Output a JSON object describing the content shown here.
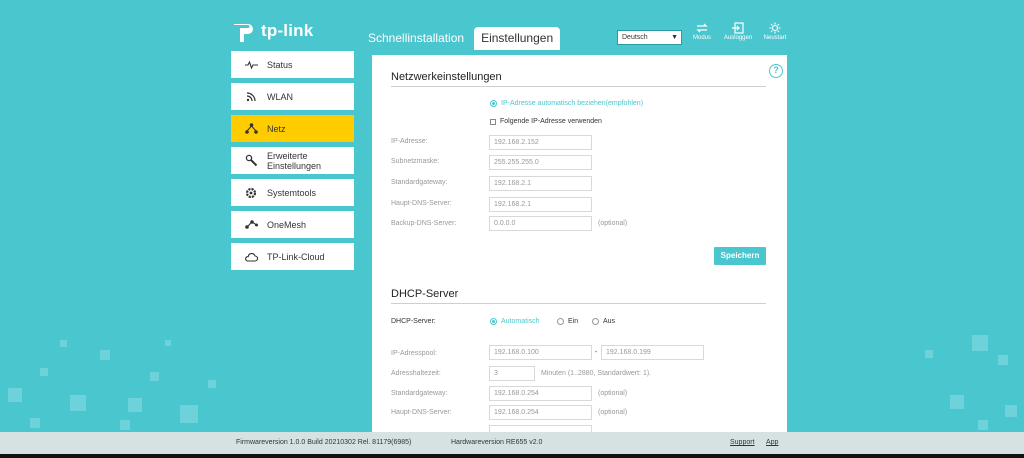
{
  "brand": {
    "name": "tp-link"
  },
  "tabs": [
    {
      "label": "Schnellinstallation",
      "active": false
    },
    {
      "label": "Einstellungen",
      "active": true
    }
  ],
  "header": {
    "language": "Deutsch",
    "buttons": [
      {
        "label": "Modus",
        "icon": "mode-switch-icon"
      },
      {
        "label": "Ausloggen",
        "icon": "logout-icon"
      },
      {
        "label": "Neustart",
        "icon": "reboot-icon"
      }
    ]
  },
  "sidebar": {
    "items": [
      {
        "label": "Status",
        "icon": "pulse-icon"
      },
      {
        "label": "WLAN",
        "icon": "wifi-icon"
      },
      {
        "label": "Netz",
        "icon": "network-icon",
        "active": true
      },
      {
        "label": "Erweiterte\nEinstellungen",
        "line1": "Erweiterte",
        "line2": "Einstellungen",
        "icon": "wrench-gear-icon"
      },
      {
        "label": "Systemtools",
        "icon": "gear-icon"
      },
      {
        "label": "OneMesh",
        "icon": "mesh-icon"
      },
      {
        "label": "TP-Link-Cloud",
        "icon": "cloud-icon"
      }
    ]
  },
  "network": {
    "title": "Netzwerkeinstellungen",
    "option_auto": "IP-Adresse automatisch beziehen(empfohlen)",
    "option_manual": "Folgende IP-Adresse verwenden",
    "fields": [
      {
        "label": "IP-Adresse:",
        "value": "192.168.2.152"
      },
      {
        "label": "Subnetzmaske:",
        "value": "255.255.255.0"
      },
      {
        "label": "Standardgateway:",
        "value": "192.168.2.1"
      },
      {
        "label": "Haupt-DNS-Server:",
        "value": "192.168.2.1"
      },
      {
        "label": "Backup-DNS-Server:",
        "value": "0.0.0.0",
        "note": "(optional)"
      }
    ],
    "save_label": "Speichern"
  },
  "dhcp": {
    "title": "DHCP-Server",
    "mode_label": "DHCP-Server:",
    "modes": [
      "Automatisch",
      "Ein",
      "Aus"
    ],
    "selected_mode": "Automatisch",
    "pool_label": "IP-Adresspool:",
    "pool_start": "192.168.0.100",
    "pool_sep": "-",
    "pool_end": "192.168.0.199",
    "lease_label": "Adresshaltezeit:",
    "lease_value": "3",
    "lease_note": "Minuten (1..2880, Standardwert: 1).",
    "gateway_label": "Standardgateway:",
    "gateway_value": "192.168.0.254",
    "gateway_note": "(optional)",
    "dns_label": "Haupt-DNS-Server:",
    "dns_value": "192.168.0.254",
    "dns_note": "(optional)"
  },
  "footer": {
    "firmware": "Firmwareversion 1.0.0 Build 20210302 Rel. 81179(6985)",
    "hardware": "Hardwareversion RE655 v2.0",
    "support": "Support",
    "app": "App"
  },
  "colors": {
    "accent": "#4ac6cf",
    "active": "#ffcc00",
    "panel": "#ffffff"
  }
}
